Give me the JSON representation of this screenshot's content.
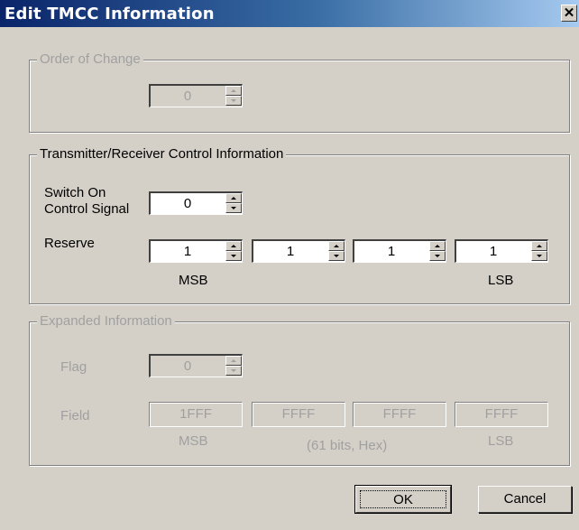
{
  "window": {
    "title": "Edit TMCC Information",
    "close_glyph": "✕"
  },
  "order_group": {
    "legend": "Order of Change",
    "value": "0"
  },
  "trc_group": {
    "legend": "Transmitter/Receiver Control Information",
    "switch_label_line1": "Switch On",
    "switch_label_line2": "Control Signal",
    "switch_value": "0",
    "reserve_label": "Reserve",
    "reserve_values": [
      "1",
      "1",
      "1",
      "1"
    ],
    "msb": "MSB",
    "lsb": "LSB"
  },
  "expanded_group": {
    "legend": "Expanded Information",
    "flag_label": "Flag",
    "flag_value": "0",
    "field_label": "Field",
    "field_values": [
      "1FFF",
      "FFFF",
      "FFFF",
      "FFFF"
    ],
    "msb": "MSB",
    "note": "(61 bits, Hex)",
    "lsb": "LSB"
  },
  "buttons": {
    "ok": "OK",
    "cancel": "Cancel"
  },
  "colors": {
    "title_gradient_start": "#0a246a",
    "title_gradient_end": "#a6caf0",
    "face": "#d4d0c8",
    "disabled_text": "#a0a0a0"
  }
}
